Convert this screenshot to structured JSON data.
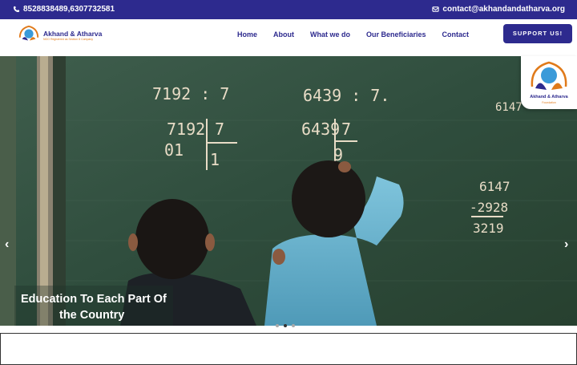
{
  "topbar": {
    "phone": "8528838489,6307732581",
    "email": "contact@akhandandatharva.org"
  },
  "logo": {
    "name": "Akhand & Atharva",
    "tagline": "NGO Registered as Section 8 Company"
  },
  "nav": {
    "items": [
      "Home",
      "About",
      "What we do",
      "Our Beneficiaries",
      "Contact"
    ]
  },
  "support_button": "SUPPORT US!",
  "badge": {
    "name": "Akhand & Atharva",
    "tagline": "Foundation"
  },
  "hero": {
    "caption_line1": "Education To Each Part Of",
    "caption_line2": "the Country",
    "chalk": {
      "eq_left": "7192 : 7",
      "eq_right": "6439 : 7.",
      "div_left_top": "7192",
      "div_left_divisor": "7",
      "div_left_q": "01",
      "div_left_r": "1",
      "div_right_top": "6439",
      "div_right_divisor": "7",
      "div_right_r": "9",
      "corner": "6147",
      "sub_top": "6147",
      "sub_mid": "-2928",
      "sub_bot": "3219"
    },
    "slide_count": 3,
    "active_slide": 2
  },
  "colors": {
    "brand": "#2d2a8e",
    "accent": "#e07a1a"
  }
}
